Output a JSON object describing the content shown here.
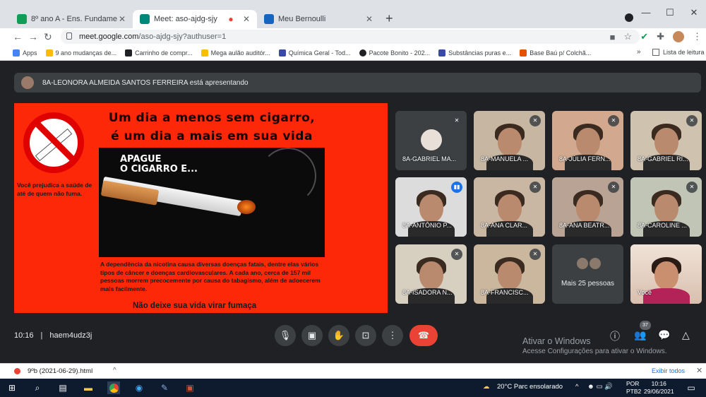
{
  "browser": {
    "tabs": [
      {
        "label": "8º ano A - Ens. Fundamental Colé",
        "color": "#0f9d58"
      },
      {
        "label": "Meet: aso-ajdg-sjy",
        "color": "#00897b"
      },
      {
        "label": "Meu Bernoulli",
        "color": "#1565c0"
      }
    ],
    "url_host": "meet.google.com",
    "url_path": "/aso-ajdg-sjy?authuser=1",
    "bookmarks": [
      {
        "label": "Apps",
        "color": "#4285f4"
      },
      {
        "label": "9 ano mudanças de...",
        "color": "#fbbc05"
      },
      {
        "label": "Carrinho de compr...",
        "color": "#202124"
      },
      {
        "label": "Mega aulão auditór...",
        "color": "#fbbc05"
      },
      {
        "label": "Química Geral - Tod...",
        "color": "#3949ab"
      },
      {
        "label": "Pacote Bonito - 202...",
        "color": "#202124"
      },
      {
        "label": "Substâncias puras e...",
        "color": "#3949ab"
      },
      {
        "label": "Base Baú p/ Colchã...",
        "color": "#e65100"
      }
    ],
    "bookmarks_more": "»",
    "reading_list": "Lista de leitura"
  },
  "meet": {
    "presenting_banner": "8A-LEONORA ALMEIDA SANTOS FERREIRA está apresentando",
    "slide": {
      "title_line1": "Um dia a menos sem cigarro,",
      "title_line2": "é um dia a mais em sua vida",
      "side_text": "Você prejudica a saúde de até de quem não fuma.",
      "poster_title_1": "APAGUE",
      "poster_title_2": "O CIGARRO E...",
      "body_text": "A dependência da nicotina causa diversas doenças fatais, dentre elas vários tipos de câncer e doenças cardiovasculares. A cada ano, cerca de 157 mil pessoas morrem precocemente por causa do tabagismo, além de adoecerem mais facilmente.",
      "footer_text": "Não deixe sua vida virar fumaça"
    },
    "participants": [
      {
        "name": "8A-GABRIEL MA...",
        "bg": "#3c4043",
        "state": "muted"
      },
      {
        "name": "8A-MANUELA ...",
        "bg": "#c7b6a1",
        "state": "muted"
      },
      {
        "name": "8A-JÚLIA FERN...",
        "bg": "#d2a98e",
        "state": "muted"
      },
      {
        "name": "8A-GABRIEL RI...",
        "bg": "#cfc2ae",
        "state": "muted"
      },
      {
        "name": "8A-ANTÔNIO P...",
        "bg": "#dcdcdc",
        "state": "speaking"
      },
      {
        "name": "8A-ANA CLAR...",
        "bg": "#c9b7a3",
        "state": "muted"
      },
      {
        "name": "8A-ANA BEATR...",
        "bg": "#b8a394",
        "state": "muted"
      },
      {
        "name": "8A-CAROLINE ...",
        "bg": "#c1c5b5",
        "state": "muted"
      },
      {
        "name": "8A-ISADORA N...",
        "bg": "#d7cfc0",
        "state": "muted"
      },
      {
        "name": "8A-FRANCISC...",
        "bg": "#cbb69e",
        "state": "muted"
      }
    ],
    "more_people": "Mais 25 pessoas",
    "self_label": "Você",
    "time": "10:16",
    "separator": "|",
    "meeting_code": "haem4udz3j",
    "participant_count": "37",
    "windows_activation_title": "Ativar o Windows",
    "windows_activation_sub": "Acesse Configurações para ativar o Windows."
  },
  "download": {
    "file": "9ºb (2021-06-29).html",
    "show_all": "Exibir todos"
  },
  "taskbar": {
    "weather": "20°C  Parc ensolarado",
    "lang_1": "POR",
    "lang_2": "PTB2",
    "time": "10:16",
    "date": "29/06/2021"
  }
}
